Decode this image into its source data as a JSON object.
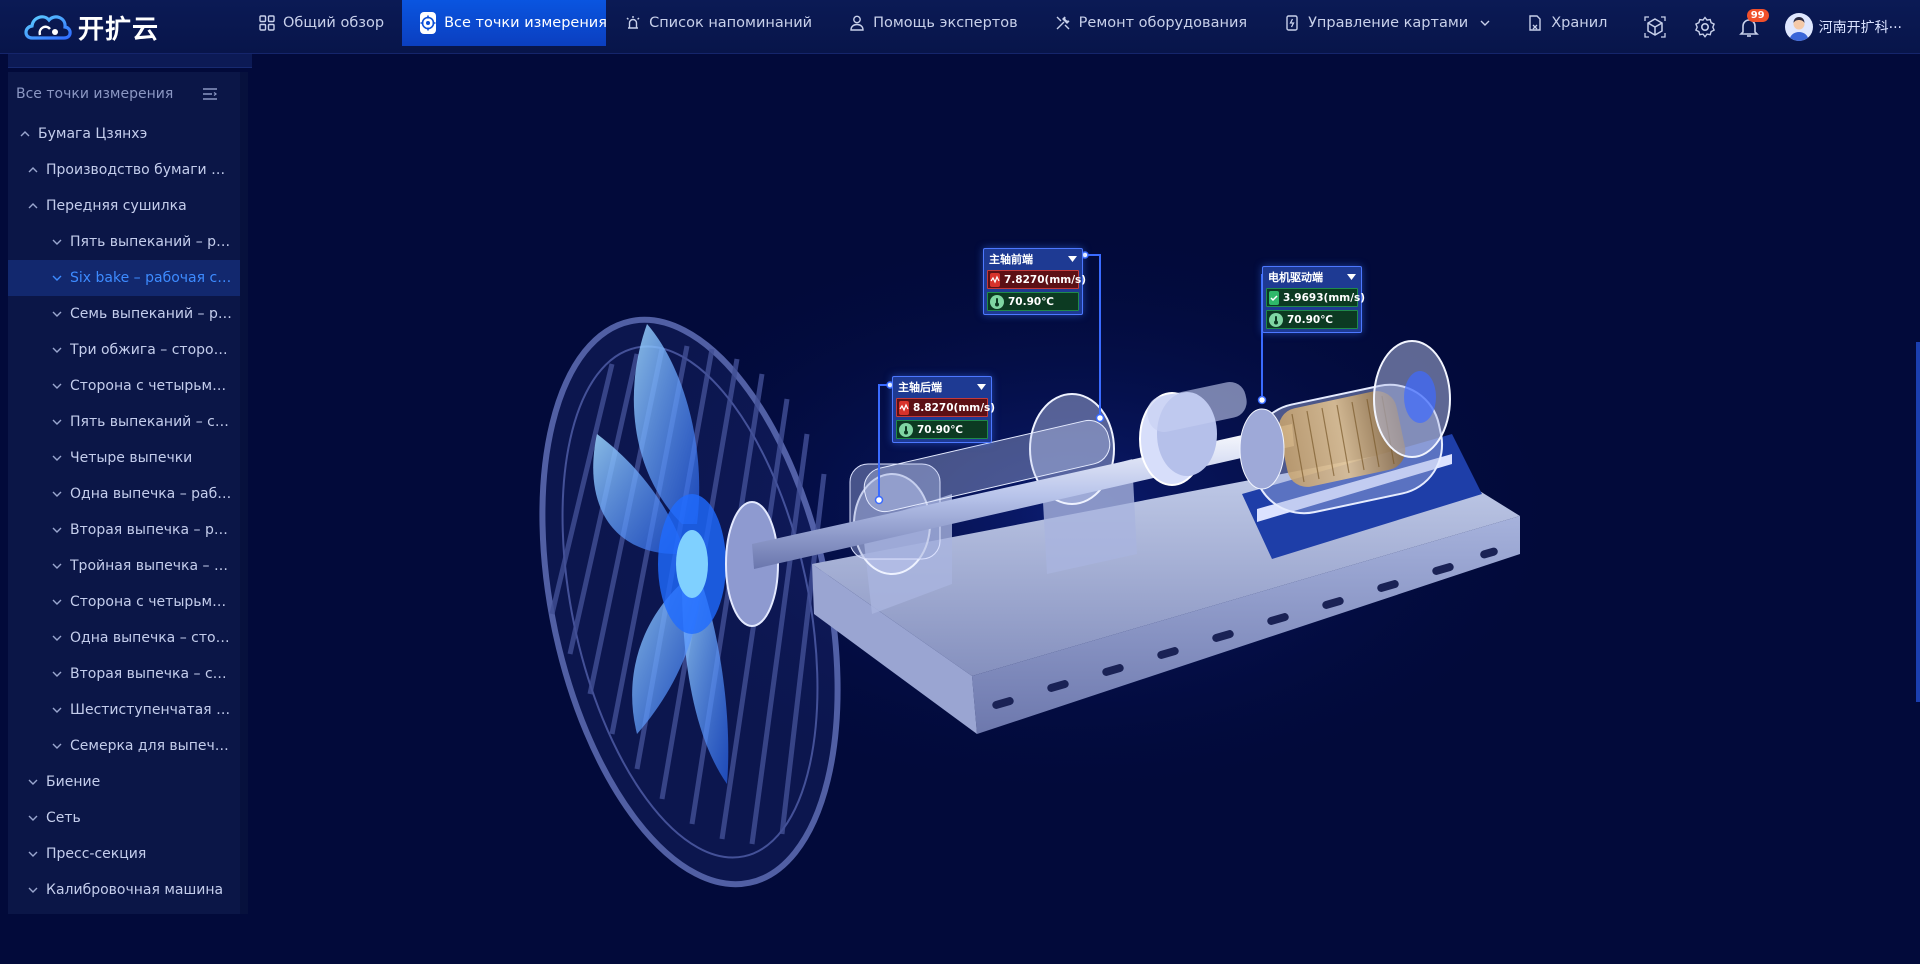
{
  "app": {
    "logo_text": "开扩云"
  },
  "nav": {
    "items": [
      {
        "label": "Общий обзор",
        "icon": "grid-icon",
        "active": false
      },
      {
        "label": "Все точки измерения",
        "icon": "target-icon",
        "active": true
      },
      {
        "label": "Список напоминаний",
        "icon": "alarm-icon",
        "active": false
      },
      {
        "label": "Помощь экспертов",
        "icon": "expert-icon",
        "active": false
      },
      {
        "label": "Ремонт оборудования",
        "icon": "wrench-icon",
        "active": false
      },
      {
        "label": "Управление картами",
        "icon": "card-icon",
        "active": false
      },
      {
        "label": "Хранил",
        "icon": "storage-icon",
        "active": false
      }
    ]
  },
  "header": {
    "notification_count": "99",
    "user_name": "河南开扩科···"
  },
  "sidebar": {
    "title": "Все точки измерения",
    "items": [
      {
        "label": "Бумага Цзянхэ",
        "level": 0,
        "expanded": true
      },
      {
        "label": "Производство бумаги шестой линией",
        "level": 1,
        "expanded": true
      },
      {
        "label": "Передняя сушилка",
        "level": 1,
        "expanded": true
      },
      {
        "label": "Пять выпеканий – рабочая сторона",
        "level": 2,
        "expanded": false
      },
      {
        "label": "Six bake – рабочая сторона",
        "level": 2,
        "expanded": false,
        "selected": true
      },
      {
        "label": "Семь выпеканий – рабочая сторона",
        "level": 2,
        "expanded": false
      },
      {
        "label": "Три обжига – сторона привода",
        "level": 2,
        "expanded": false
      },
      {
        "label": "Сторона с четырьмя обжигами",
        "level": 2,
        "expanded": false
      },
      {
        "label": "Пять выпеканий – сторона привода",
        "level": 2,
        "expanded": false
      },
      {
        "label": "Четыре выпечки",
        "level": 2,
        "expanded": false
      },
      {
        "label": "Одна выпечка – рабочая сторона",
        "level": 2,
        "expanded": false
      },
      {
        "label": "Вторая выпечка – рабочая сторона",
        "level": 2,
        "expanded": false
      },
      {
        "label": "Тройная выпечка – рабочая сторона",
        "level": 2,
        "expanded": false
      },
      {
        "label": "Сторона с четырьмя обжигами",
        "level": 2,
        "expanded": false
      },
      {
        "label": "Одна выпечка – сторона привода",
        "level": 2,
        "expanded": false
      },
      {
        "label": "Вторая выпечка – со стороны привода",
        "level": 2,
        "expanded": false
      },
      {
        "label": "Шестиступенчатая выпечка",
        "level": 2,
        "expanded": false
      },
      {
        "label": "Семерка для выпечки",
        "level": 2,
        "expanded": false
      },
      {
        "label": "Биение",
        "level": 1,
        "expanded": false
      },
      {
        "label": "Сеть",
        "level": 1,
        "expanded": false
      },
      {
        "label": "Пресс-секция",
        "level": 1,
        "expanded": false
      },
      {
        "label": "Калибровочная машина",
        "level": 1,
        "expanded": false
      }
    ]
  },
  "points": [
    {
      "title": "主轴前端",
      "vibration": "7.8270(mm/s)",
      "temperature": "70.90℃",
      "vibration_status": "alarm",
      "status_color": "#c43a3a"
    },
    {
      "title": "主轴后端",
      "vibration": "8.8270(mm/s)",
      "temperature": "70.90℃",
      "vibration_status": "alarm",
      "status_color": "#c43a3a"
    },
    {
      "title": "电机驱动端",
      "vibration": "3.9693(mm/s)",
      "temperature": "70.90℃",
      "vibration_status": "normal",
      "status_color": "#1f8a4b"
    }
  ],
  "colors": {
    "background": "#020a3a",
    "accent": "#0a55e0",
    "alarm": "#c43a3a",
    "normal": "#1f8a4b"
  }
}
